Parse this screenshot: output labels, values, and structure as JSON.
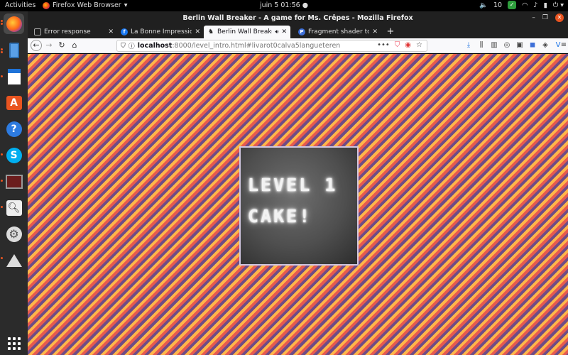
{
  "topbar": {
    "activities": "Activities",
    "app_name": "Firefox Web Browser",
    "clock": "juin 5  01:56",
    "volume_level": "10"
  },
  "window": {
    "title": "Berlin Wall Breaker - A game for Ms. Crêpes - Mozilla Firefox"
  },
  "tabs": [
    {
      "label": "Error response",
      "favicon": "blank-page-icon",
      "active": false
    },
    {
      "label": "La Bonne Impression - B",
      "favicon": "facebook-icon",
      "active": false
    },
    {
      "label": "Berlin Wall Breaker - A",
      "favicon": "game-icon",
      "active": true
    },
    {
      "label": "Fragment shader too ma",
      "favicon": "pocket-p-icon",
      "active": false
    }
  ],
  "urlbar": {
    "host": "localhost",
    "path": ":8000/level_intro.html#livarot0calva5langueteren"
  },
  "game": {
    "line1": "LEVEL 1",
    "line2": "CAKE!"
  },
  "colors": {
    "stripe_orange": "#ffb64a",
    "stripe_red": "#e65a4f",
    "stripe_purple": "#6e4c86",
    "ubuntu_orange": "#e95420",
    "dock_bg": "#2b2b2b"
  }
}
